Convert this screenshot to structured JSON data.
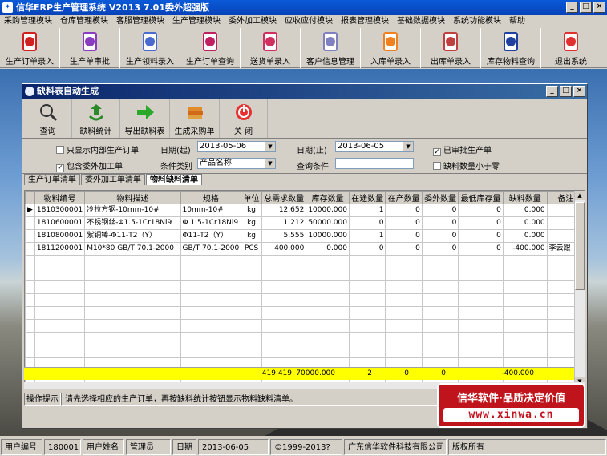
{
  "app": {
    "title": "信华ERP生产管理系统  V2013  7.01委外超强版"
  },
  "menu": [
    "采购管理模块",
    "仓库管理模块",
    "客服管理模块",
    "生产管理模块",
    "委外加工模块",
    "应收应付模块",
    "报表管理模块",
    "基础数据模块",
    "系统功能模块",
    "帮助"
  ],
  "toolbar": [
    {
      "label": "生产订单录入",
      "icon": "pdf-icon",
      "color": "#d02020"
    },
    {
      "label": "生产单审批",
      "icon": "paint-icon",
      "color": "#8a3cc0"
    },
    {
      "label": "生产领料录入",
      "icon": "chart-icon",
      "color": "#4a6ad0"
    },
    {
      "label": "生产订单查询",
      "icon": "magnifier-icon",
      "color": "#c02060"
    },
    {
      "label": "送货单录入",
      "icon": "truck-icon",
      "color": "#d03060"
    },
    {
      "label": "客户信息管理",
      "icon": "user-icon",
      "color": "#8080c0"
    },
    {
      "label": "入库单录入",
      "icon": "flower-icon",
      "color": "#f08020"
    },
    {
      "label": "出库单录入",
      "icon": "box-icon",
      "color": "#c04040"
    },
    {
      "label": "库存物料查询",
      "icon": "gem-icon",
      "color": "#2040a0"
    },
    {
      "label": "退出系统",
      "icon": "exit-icon",
      "color": "#e03030"
    }
  ],
  "child": {
    "title": "缺料表自动生成",
    "toolbar": [
      {
        "label": "查询",
        "icon": "magnifier-icon"
      },
      {
        "label": "缺料统计",
        "icon": "recycle-icon"
      },
      {
        "label": "导出缺料表",
        "icon": "arrow-right-icon"
      },
      {
        "label": "生成采购单",
        "icon": "books-icon"
      },
      {
        "label": "关 闭",
        "icon": "power-icon"
      }
    ],
    "filter": {
      "only_internal": "只显示内部生产订单",
      "include_outsource": "包含委外加工单",
      "date_start_label": "日期(起)",
      "date_start": "2013-05-06",
      "date_end_label": "日期(止)",
      "date_end": "2013-06-05",
      "approved": "已审批生产单",
      "cond_type_label": "条件类别",
      "cond_type": "产品名称",
      "query_cond_label": "查询条件",
      "query_cond": "",
      "shortage_lt_zero": "缺料数量小于零"
    },
    "tabs": [
      "生产订单清单",
      "委外加工单清单",
      "物料缺料清单"
    ],
    "columns": [
      "物料编号",
      "物料描述",
      "规格",
      "单位",
      "总需求数量",
      "库存数量",
      "在途数量",
      "在产数量",
      "委外数量",
      "最低库存量",
      "缺料数量",
      "备注"
    ],
    "rows": [
      [
        "1810300001",
        "冷拉方钢-10mm-10#",
        "10mm-10#",
        "kg",
        "12.652",
        "10000.000",
        "1",
        "0",
        "0",
        "0",
        "0.000",
        ""
      ],
      [
        "1810600001",
        "不锈钢丝-Φ1.5-1Cr18Ni9",
        "Φ 1.5-1Cr18Ni9",
        "kg",
        "1.212",
        "50000.000",
        "0",
        "0",
        "0",
        "0",
        "0.000",
        ""
      ],
      [
        "1810800001",
        "紫铜棒-Φ11-T2（Y）",
        "Φ11-T2（Y）",
        "kg",
        "5.555",
        "10000.000",
        "1",
        "0",
        "0",
        "0",
        "0.000",
        ""
      ],
      [
        "1811200001",
        "M10*80 GB/T 70.1-2000",
        "GB/T 70.1-2000",
        "PCS",
        "400.000",
        "0.000",
        "0",
        "0",
        "0",
        "0",
        "-400.000",
        "李云跟"
      ]
    ],
    "totals": {
      "total_demand": "419.419",
      "stock": "70000.000",
      "in_transit": "2",
      "in_production": "0",
      "outsourced": "0",
      "shortage": "-400.000"
    },
    "hint_label": "操作提示",
    "hint_text": "请先选择相应的生产订单，再按缺料统计按钮显示物料缺料清单。"
  },
  "status": {
    "user_id_label": "用户编号",
    "user_id": "180001",
    "user_name_label": "用户姓名",
    "user_name": "管理员",
    "date_label": "日期",
    "date": "2013-06-05",
    "copyright": "©1999-2013?",
    "company": "广东信华软件科技有限公司",
    "rights": "版权所有"
  },
  "brand": {
    "line1": "信华软件·品质决定价值",
    "line2": "www.xinwa.cn"
  }
}
